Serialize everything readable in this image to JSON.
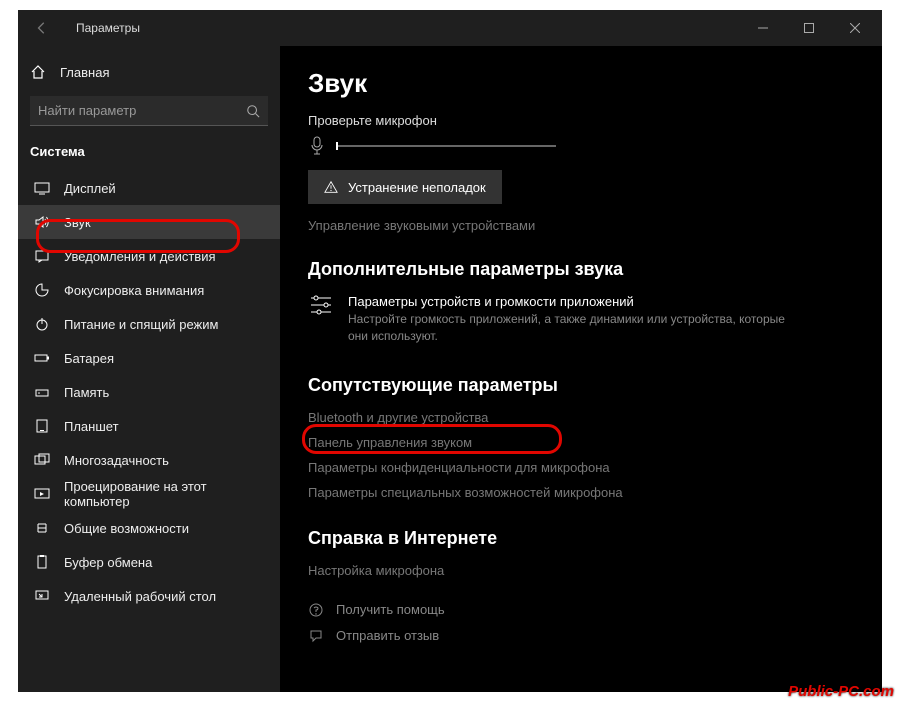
{
  "titlebar": {
    "title": "Параметры"
  },
  "sidebar": {
    "home_label": "Главная",
    "search_placeholder": "Найти параметр",
    "section_title": "Система",
    "items": [
      {
        "label": "Дисплей",
        "icon": "display"
      },
      {
        "label": "Звук",
        "icon": "sound",
        "selected": true
      },
      {
        "label": "Уведомления и действия",
        "icon": "notification"
      },
      {
        "label": "Фокусировка внимания",
        "icon": "focus"
      },
      {
        "label": "Питание и спящий режим",
        "icon": "power"
      },
      {
        "label": "Батарея",
        "icon": "battery"
      },
      {
        "label": "Память",
        "icon": "storage"
      },
      {
        "label": "Планшет",
        "icon": "tablet"
      },
      {
        "label": "Многозадачность",
        "icon": "multitask"
      },
      {
        "label": "Проецирование на этот компьютер",
        "icon": "project"
      },
      {
        "label": "Общие возможности",
        "icon": "shared"
      },
      {
        "label": "Буфер обмена",
        "icon": "clipboard"
      },
      {
        "label": "Удаленный рабочий стол",
        "icon": "remote"
      }
    ]
  },
  "main": {
    "page_title": "Звук",
    "mic_section": {
      "label": "Проверьте микрофон"
    },
    "troubleshoot_label": "Устранение неполадок",
    "manage_devices_link": "Управление звуковыми устройствами",
    "advanced": {
      "title": "Дополнительные параметры звука",
      "app_volume_title": "Параметры устройств и громкости приложений",
      "app_volume_desc": "Настройте громкость приложений, а также динамики или устройства, которые они используют."
    },
    "related": {
      "title": "Сопутствующие параметры",
      "links": [
        "Bluetooth и другие устройства",
        "Панель управления звуком",
        "Параметры конфиденциальности для микрофона",
        "Параметры специальных возможностей микрофона"
      ]
    },
    "help": {
      "title": "Справка в Интернете",
      "links": [
        "Настройка микрофона"
      ]
    },
    "footer": {
      "get_help": "Получить помощь",
      "feedback": "Отправить отзыв"
    }
  },
  "watermark": "Public-PC.com"
}
